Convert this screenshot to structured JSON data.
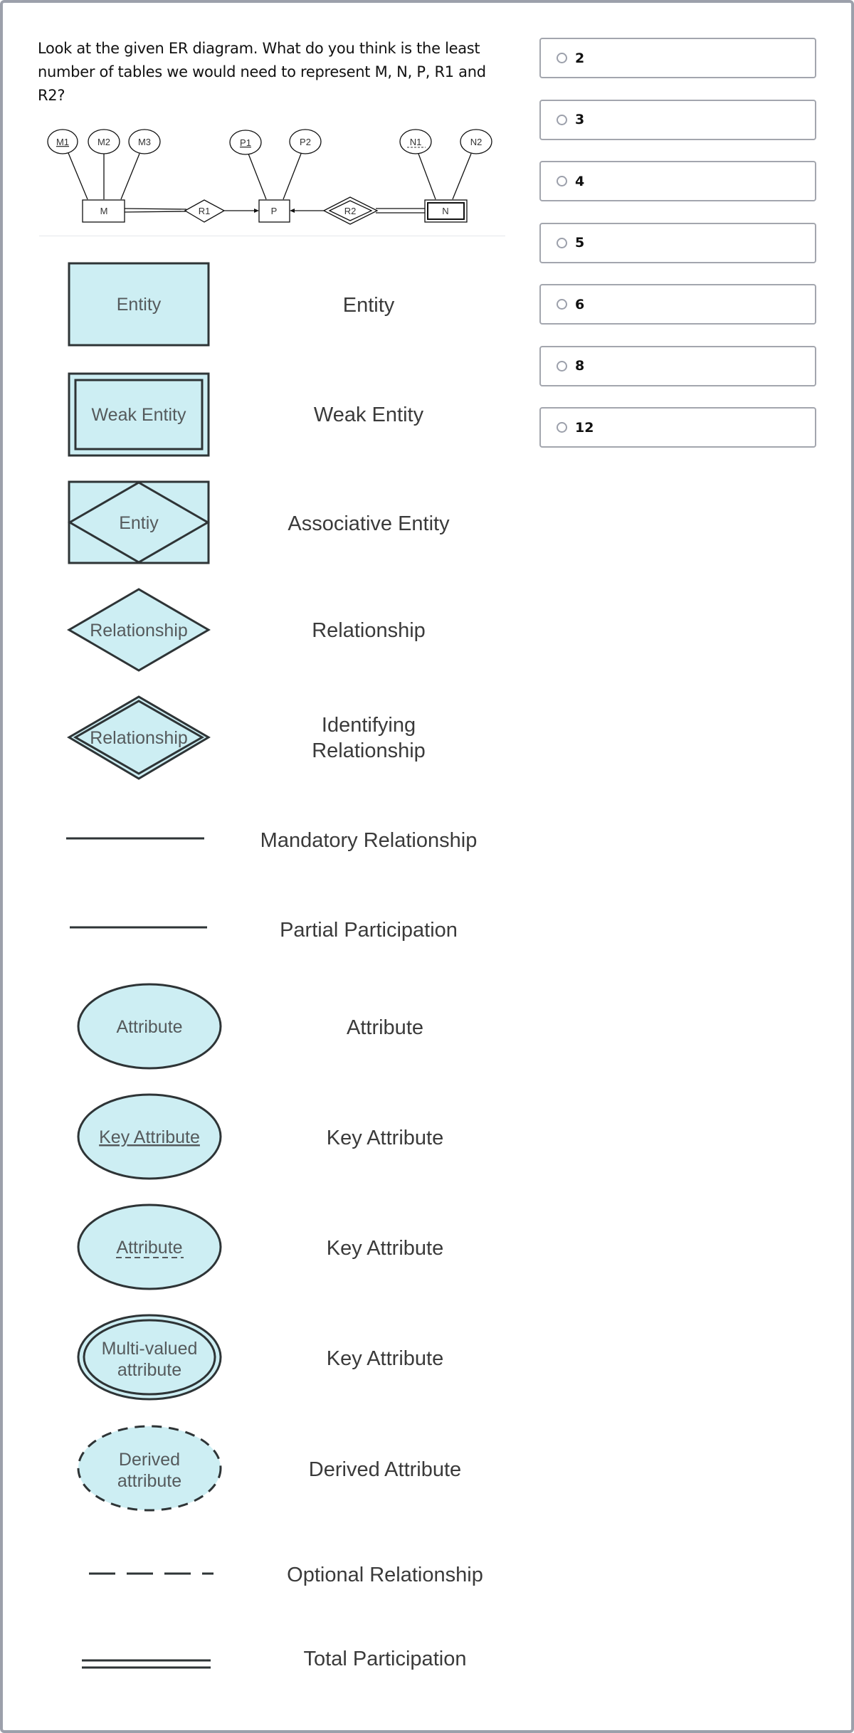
{
  "question": {
    "text": "Look at the given ER diagram. What do you think is the least number of tables we would need to represent M, N, P, R1 and R2?"
  },
  "er_diagram": {
    "entities": [
      {
        "label": "M",
        "type": "entity"
      },
      {
        "label": "P",
        "type": "entity"
      },
      {
        "label": "N",
        "type": "weak-entity"
      }
    ],
    "attributes": [
      {
        "label": "M1",
        "of": "M",
        "key": "key"
      },
      {
        "label": "M2",
        "of": "M",
        "key": "none"
      },
      {
        "label": "M3",
        "of": "M",
        "key": "none"
      },
      {
        "label": "P1",
        "of": "P",
        "key": "key"
      },
      {
        "label": "P2",
        "of": "P",
        "key": "none"
      },
      {
        "label": "N1",
        "of": "N",
        "key": "partial"
      },
      {
        "label": "N2",
        "of": "N",
        "key": "none"
      }
    ],
    "relationships": [
      {
        "label": "R1",
        "type": "relationship",
        "between": [
          "M",
          "P"
        ],
        "participation": "total M, arrow to P"
      },
      {
        "label": "R2",
        "type": "identifying-relationship",
        "between": [
          "N",
          "P"
        ],
        "participation": "total N, arrow to P"
      }
    ]
  },
  "legend": {
    "items": [
      {
        "symbol": "entity",
        "symbol_text": "Entity",
        "label": "Entity"
      },
      {
        "symbol": "weak-entity",
        "symbol_text": "Weak Entity",
        "label": "Weak Entity"
      },
      {
        "symbol": "associative-entity",
        "symbol_text": "Entiy",
        "label": "Associative Entity"
      },
      {
        "symbol": "relationship",
        "symbol_text": "Relationship",
        "label": "Relationship"
      },
      {
        "symbol": "identifying-relationship",
        "symbol_text": "Relationship",
        "label_line1": "Identifying",
        "label_line2": "Relationship"
      },
      {
        "symbol": "solid-line",
        "label": "Mandatory Relationship"
      },
      {
        "symbol": "solid-line",
        "label": "Partial Participation"
      },
      {
        "symbol": "attribute",
        "symbol_text": "Attribute",
        "label": "Attribute"
      },
      {
        "symbol": "key-attribute",
        "symbol_text": "Key Attribute",
        "label": "Key Attribute"
      },
      {
        "symbol": "partial-key-attribute",
        "symbol_text": "Attribute",
        "label": "Key Attribute"
      },
      {
        "symbol": "multivalued-attribute",
        "symbol_text_line1": "Multi-valued",
        "symbol_text_line2": "attribute",
        "label": "Key Attribute"
      },
      {
        "symbol": "derived-attribute",
        "symbol_text_line1": "Derived",
        "symbol_text_line2": "attribute",
        "label": "Derived Attribute"
      },
      {
        "symbol": "dashed-line",
        "label": "Optional Relationship"
      },
      {
        "symbol": "double-line",
        "label": "Total Participation"
      }
    ],
    "colors": {
      "fill": "#cdeef3",
      "stroke": "#2e3436",
      "text": "#3a3a3a"
    }
  },
  "options": [
    {
      "label": "2",
      "selected": false
    },
    {
      "label": "3",
      "selected": false
    },
    {
      "label": "4",
      "selected": false
    },
    {
      "label": "5",
      "selected": false
    },
    {
      "label": "6",
      "selected": false
    },
    {
      "label": "8",
      "selected": false
    },
    {
      "label": "12",
      "selected": false
    }
  ]
}
